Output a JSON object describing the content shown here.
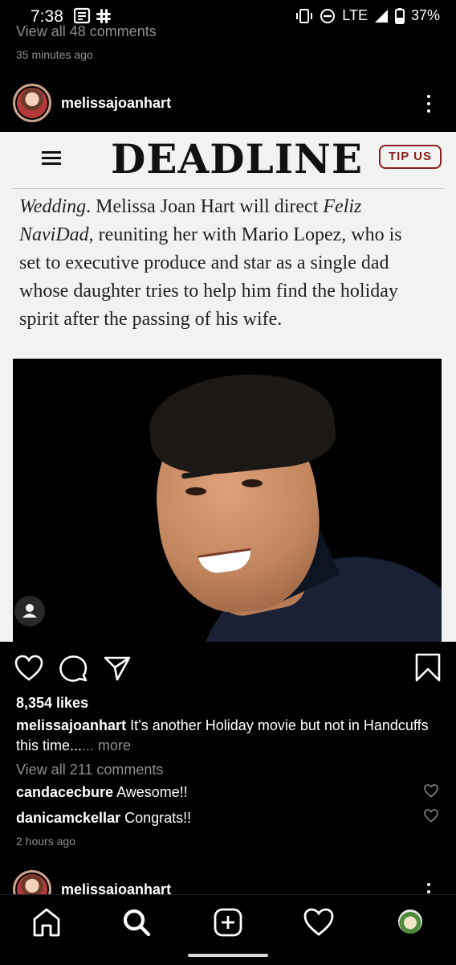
{
  "status_bar": {
    "time": "7:38",
    "network": "LTE",
    "battery": "37%",
    "left_icons": [
      "news-icon",
      "slack-icon"
    ],
    "right_icons": [
      "vibrate-icon",
      "do-not-disturb-icon",
      "signal-icon",
      "battery-icon"
    ]
  },
  "previous_post": {
    "view_comments": "View all 48 comments",
    "time_ago": "35 minutes ago"
  },
  "post": {
    "username": "melissajoanhart",
    "image": {
      "site_logo": "DEADLINE",
      "tip_button": "TIP US",
      "article_lines": [
        {
          "parts": [
            {
              "t": "Wedding",
              "i": true
            },
            {
              "t": ". Melissa Joan Hart will direct ",
              "i": false
            },
            {
              "t": "Feliz",
              "i": true
            }
          ]
        },
        {
          "parts": [
            {
              "t": "NaviDad",
              "i": true
            },
            {
              "t": ", reuniting her with Mario Lopez, who is",
              "i": false
            }
          ]
        },
        {
          "parts": [
            {
              "t": "set to executive produce and star as a single dad",
              "i": false
            }
          ]
        },
        {
          "parts": [
            {
              "t": "whose daughter tries to help him find the holiday",
              "i": false
            }
          ]
        },
        {
          "parts": [
            {
              "t": "spirit after the passing of his wife.",
              "i": false
            }
          ]
        }
      ]
    },
    "likes": "8,354 likes",
    "caption_user": "melissajoanhart",
    "caption_text": " It’s another Holiday movie but not in Handcuffs this time...",
    "caption_more": "... more",
    "view_comments": "View all 211 comments",
    "comments": [
      {
        "user": "candacecbure",
        "text": " Awesome!!"
      },
      {
        "user": "danicamckellar",
        "text": " Congrats!!"
      }
    ],
    "time_ago": "2 hours ago"
  },
  "next_post": {
    "username": "melissajoanhart"
  },
  "nav": {
    "items": [
      "home-icon",
      "search-icon",
      "new-post-icon",
      "activity-icon",
      "profile-icon"
    ]
  },
  "colors": {
    "background": "#000000",
    "muted_text": "#8e8e8e",
    "deadline_red": "#8b1f1f"
  }
}
